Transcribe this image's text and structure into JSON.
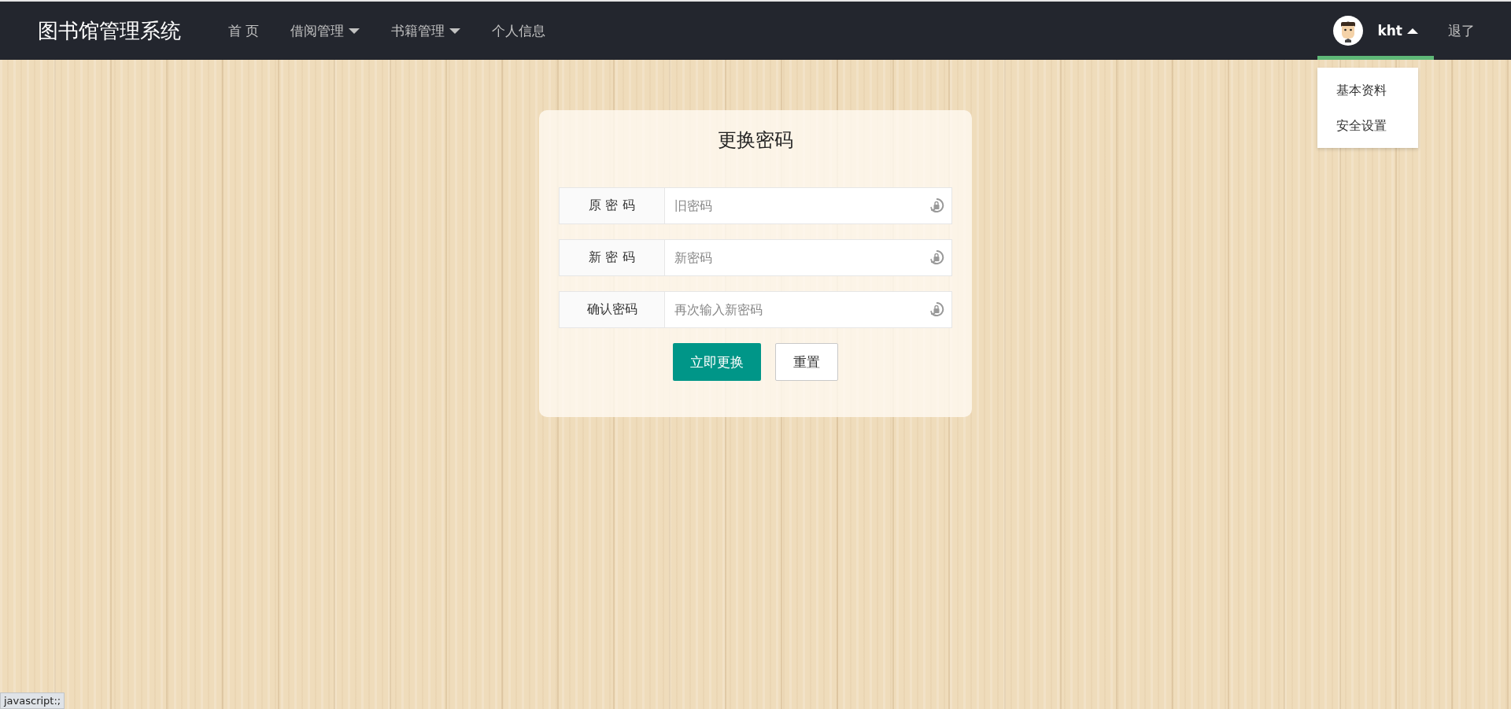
{
  "brand": "图书馆管理系统",
  "nav": [
    {
      "label": "首 页",
      "has_menu": false
    },
    {
      "label": "借阅管理",
      "has_menu": true
    },
    {
      "label": "书籍管理",
      "has_menu": true
    },
    {
      "label": "个人信息",
      "has_menu": false
    }
  ],
  "user": {
    "name": "kht",
    "expanded": true,
    "menu": [
      "基本资料",
      "安全设置"
    ]
  },
  "logout": "退了",
  "form": {
    "title": "更换密码",
    "fields": [
      {
        "label": "原 密 码",
        "placeholder": "旧密码"
      },
      {
        "label": "新 密 码",
        "placeholder": "新密码"
      },
      {
        "label": "确认密码",
        "placeholder": "再次输入新密码"
      }
    ],
    "submit": "立即更换",
    "reset": "重置"
  },
  "status_bar": "javascript:;"
}
